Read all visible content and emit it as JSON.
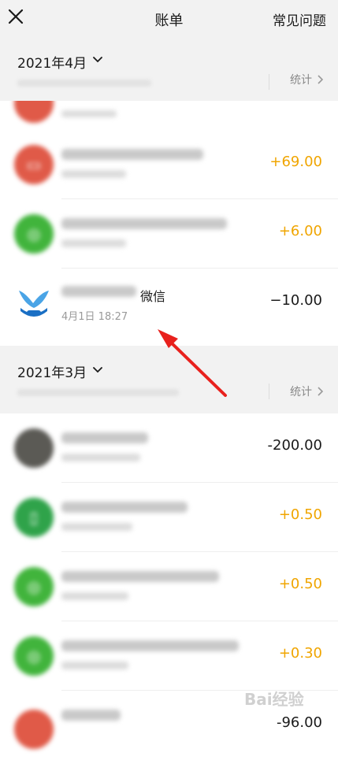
{
  "header": {
    "title": "账单",
    "faq_label": "常见问题"
  },
  "sections": {
    "april": {
      "month_label": "2021年4月",
      "stats_label": "统计"
    },
    "march": {
      "month_label": "2021年3月",
      "stats_label": "统计"
    }
  },
  "april_rows": [
    {
      "amount": "+69.00",
      "avatar_color": "#e05a48",
      "icon": "red-packet-icon"
    },
    {
      "amount": "+6.00",
      "avatar_color": "#41b43c",
      "icon": "wechat-icon"
    },
    {
      "title_suffix": "微信",
      "time": "4月1日 18:27",
      "amount": "−10.00",
      "icon": "app-logo-icon"
    }
  ],
  "march_rows": [
    {
      "amount": "-200.00",
      "avatar_color": "#5b5a55",
      "icon": "user-avatar"
    },
    {
      "amount": "+0.50",
      "avatar_color": "#2fa34a",
      "icon": "document-icon"
    },
    {
      "amount": "+0.50",
      "avatar_color": "#41b43c",
      "icon": "wechat-icon"
    },
    {
      "amount": "+0.30",
      "avatar_color": "#41b43c",
      "icon": "wechat-icon"
    },
    {
      "amount": "-96.00",
      "avatar_color": "#e05a48",
      "icon": "app-icon"
    }
  ],
  "colors": {
    "income": "#f0a500",
    "expense": "#1a1a1a",
    "arrow": "#e8211d"
  },
  "watermark": "Bai经验"
}
